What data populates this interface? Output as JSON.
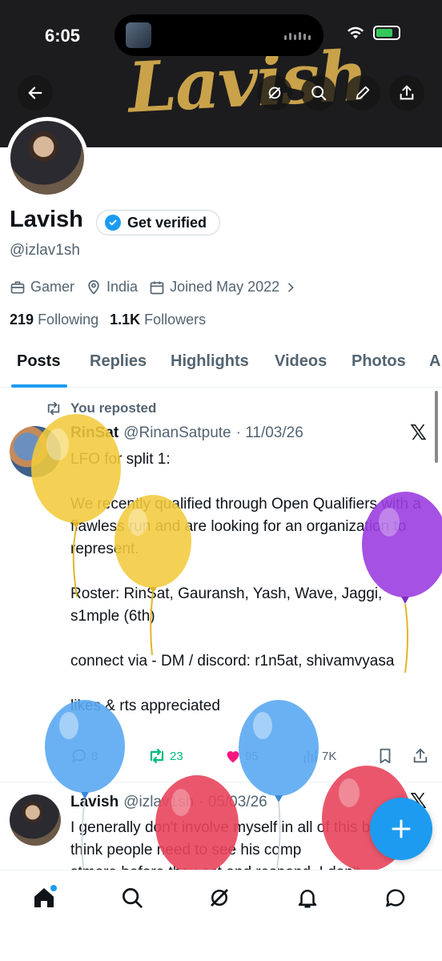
{
  "status_bar": {
    "time": "6:05"
  },
  "banner": {
    "text": "Lavish"
  },
  "profile": {
    "name": "Lavish",
    "verify_label": "Get verified",
    "handle": "@izlav1sh",
    "category": "Gamer",
    "location": "India",
    "joined": "Joined May 2022",
    "following_count": "219",
    "following_label": "Following",
    "followers_count": "1.1K",
    "followers_label": "Followers"
  },
  "tabs": [
    {
      "label": "Posts"
    },
    {
      "label": "Replies"
    },
    {
      "label": "Highlights"
    },
    {
      "label": "Videos"
    },
    {
      "label": "Photos"
    },
    {
      "label": "A"
    }
  ],
  "post1": {
    "repost_label": "You reposted",
    "author": "RinSat",
    "handle": "@RinanSatpute",
    "date": "· 11/03/26",
    "body": "LFO for split 1:\n\nWe recently qualified through Open Qualifiers with a flawless run and are looking for an organization to represent.\n\nRoster: RinSat, Gauransh, Yash, Wave, Jaggi, s1mple (6th)\n\nconnect via - DM / discord: r1n5at, shivamvyasa\n\nlikes & rts appreciated",
    "replies": "8",
    "reposts": "23",
    "likes": "95",
    "views": "7K"
  },
  "post2": {
    "author": "Lavish",
    "handle": "@izlav1sh",
    "date": "· 05/03/26",
    "body": "I generally don't involve myself in all of this but I think people need to see his comp\nstmore before they act and respond. I don't"
  },
  "colors": {
    "accent": "#1d9bf0",
    "repost_green": "#00ba7c",
    "like_pink": "#f91880",
    "banner_gold": "#c9a24a"
  },
  "icons": {
    "back": "arrow-left-icon",
    "grok": "grok-icon",
    "search": "search-icon",
    "edit": "pencil-icon",
    "share": "share-icon",
    "compose": "plus-icon",
    "home": "home-icon",
    "explore": "search-icon",
    "grok_nav": "grok-icon",
    "notifications": "bell-icon",
    "messages": "chat-icon"
  }
}
